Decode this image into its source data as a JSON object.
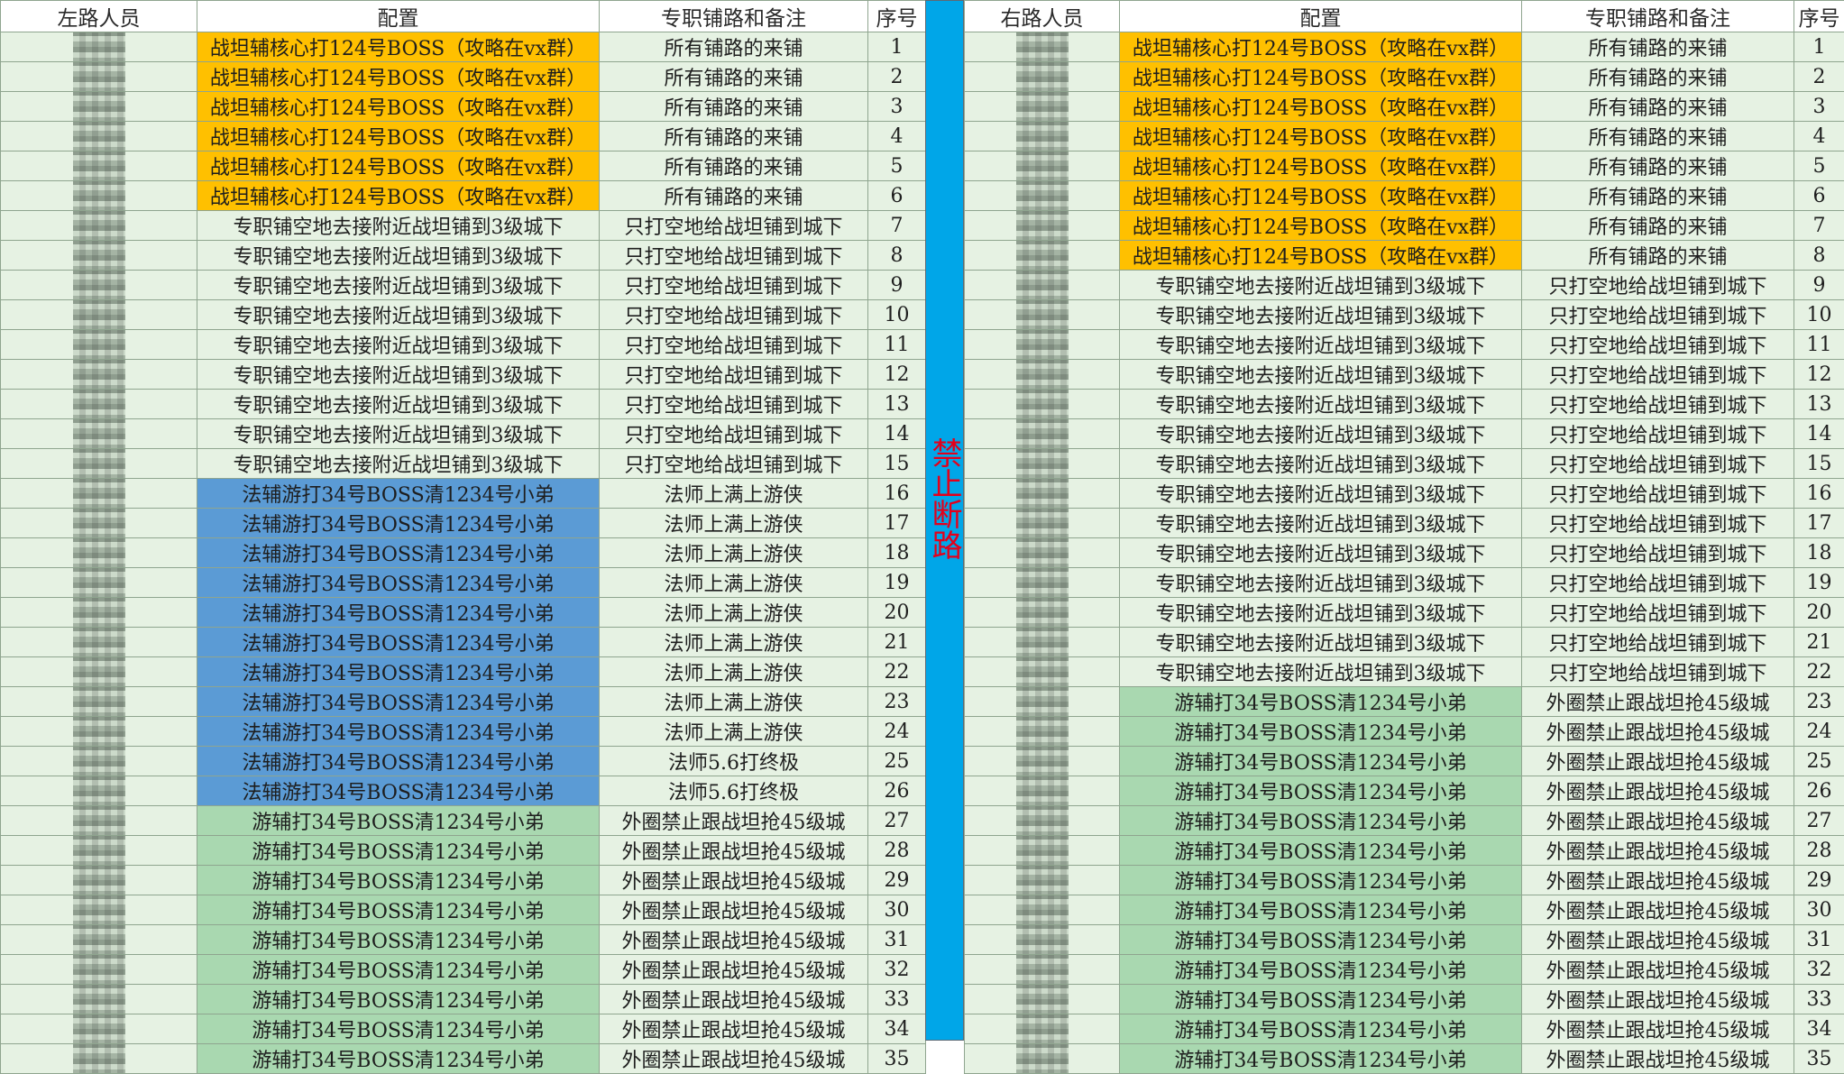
{
  "left": {
    "headers": [
      "左路人员",
      "配置",
      "专职铺路和备注",
      "序号"
    ],
    "rows": [
      {
        "name": "",
        "config": "战坦辅核心打124号BOSS（攻略在vx群）",
        "note": "所有铺路的来铺",
        "num": "1",
        "style": "org",
        "red": true
      },
      {
        "name": "",
        "config": "战坦辅核心打124号BOSS（攻略在vx群）",
        "note": "所有铺路的来铺",
        "num": "2",
        "style": "org",
        "red": true
      },
      {
        "name": "",
        "config": "战坦辅核心打124号BOSS（攻略在vx群）",
        "note": "所有铺路的来铺",
        "num": "3",
        "style": "org",
        "red": true
      },
      {
        "name": "",
        "config": "战坦辅核心打124号BOSS（攻略在vx群）",
        "note": "所有铺路的来铺",
        "num": "4",
        "style": "org",
        "red": true
      },
      {
        "name": "",
        "config": "战坦辅核心打124号BOSS（攻略在vx群）",
        "note": "所有铺路的来铺",
        "num": "5",
        "style": "org",
        "red": true
      },
      {
        "name": "",
        "config": "战坦辅核心打124号BOSS（攻略在vx群）",
        "note": "所有铺路的来铺",
        "num": "6",
        "style": "org",
        "red": true
      },
      {
        "name": "",
        "config": "专职铺空地去接附近战坦铺到3级城下",
        "note": "只打空地给战坦铺到城下",
        "num": "7",
        "style": "mid",
        "red": false
      },
      {
        "name": "",
        "config": "专职铺空地去接附近战坦铺到3级城下",
        "note": "只打空地给战坦铺到城下",
        "num": "8",
        "style": "mid",
        "red": false
      },
      {
        "name": "",
        "config": "专职铺空地去接附近战坦铺到3级城下",
        "note": "只打空地给战坦铺到城下",
        "num": "9",
        "style": "mid",
        "red": false
      },
      {
        "name": "",
        "config": "专职铺空地去接附近战坦铺到3级城下",
        "note": "只打空地给战坦铺到城下",
        "num": "10",
        "style": "mid",
        "red": false
      },
      {
        "name": "",
        "config": "专职铺空地去接附近战坦铺到3级城下",
        "note": "只打空地给战坦铺到城下",
        "num": "11",
        "style": "mid",
        "red": false
      },
      {
        "name": "",
        "config": "专职铺空地去接附近战坦铺到3级城下",
        "note": "只打空地给战坦铺到城下",
        "num": "12",
        "style": "mid",
        "red": false
      },
      {
        "name": "",
        "config": "专职铺空地去接附近战坦铺到3级城下",
        "note": "只打空地给战坦铺到城下",
        "num": "13",
        "style": "mid",
        "red": false
      },
      {
        "name": "",
        "config": "专职铺空地去接附近战坦铺到3级城下",
        "note": "只打空地给战坦铺到城下",
        "num": "14",
        "style": "mid",
        "red": false
      },
      {
        "name": "",
        "config": "专职铺空地去接附近战坦铺到3级城下",
        "note": "只打空地给战坦铺到城下",
        "num": "15",
        "style": "mid",
        "red": false
      },
      {
        "name": "",
        "config": "法辅游打34号BOSS清1234号小弟",
        "note": "法师上满上游侠",
        "num": "16",
        "style": "blu",
        "red": false
      },
      {
        "name": "",
        "config": "法辅游打34号BOSS清1234号小弟",
        "note": "法师上满上游侠",
        "num": "17",
        "style": "blu",
        "red": false
      },
      {
        "name": "",
        "config": "法辅游打34号BOSS清1234号小弟",
        "note": "法师上满上游侠",
        "num": "18",
        "style": "blu",
        "red": false
      },
      {
        "name": "",
        "config": "法辅游打34号BOSS清1234号小弟",
        "note": "法师上满上游侠",
        "num": "19",
        "style": "blu",
        "red": false
      },
      {
        "name": "",
        "config": "法辅游打34号BOSS清1234号小弟",
        "note": "法师上满上游侠",
        "num": "20",
        "style": "blu",
        "red": false
      },
      {
        "name": "",
        "config": "法辅游打34号BOSS清1234号小弟",
        "note": "法师上满上游侠",
        "num": "21",
        "style": "blu",
        "red": false
      },
      {
        "name": "",
        "config": "法辅游打34号BOSS清1234号小弟",
        "note": "法师上满上游侠",
        "num": "22",
        "style": "blu",
        "red": false
      },
      {
        "name": "",
        "config": "法辅游打34号BOSS清1234号小弟",
        "note": "法师上满上游侠",
        "num": "23",
        "style": "blu",
        "red": false
      },
      {
        "name": "",
        "config": "法辅游打34号BOSS清1234号小弟",
        "note": "法师上满上游侠",
        "num": "24",
        "style": "blu",
        "red": false
      },
      {
        "name": "",
        "config": "法辅游打34号BOSS清1234号小弟",
        "note": "法师5.6打终极",
        "num": "25",
        "style": "blu",
        "red": false
      },
      {
        "name": "",
        "config": "法辅游打34号BOSS清1234号小弟",
        "note": "法师5.6打终极",
        "num": "26",
        "style": "blu",
        "red": false
      },
      {
        "name": "",
        "config": "游辅打34号BOSS清1234号小弟",
        "note": "外圈禁止跟战坦抢45级城",
        "num": "27",
        "style": "grn",
        "red": false
      },
      {
        "name": "",
        "config": "游辅打34号BOSS清1234号小弟",
        "note": "外圈禁止跟战坦抢45级城",
        "num": "28",
        "style": "grn",
        "red": false
      },
      {
        "name": "",
        "config": "游辅打34号BOSS清1234号小弟",
        "note": "外圈禁止跟战坦抢45级城",
        "num": "29",
        "style": "grn",
        "red": false
      },
      {
        "name": "",
        "config": "游辅打34号BOSS清1234号小弟",
        "note": "外圈禁止跟战坦抢45级城",
        "num": "30",
        "style": "grn",
        "red": false
      },
      {
        "name": "",
        "config": "游辅打34号BOSS清1234号小弟",
        "note": "外圈禁止跟战坦抢45级城",
        "num": "31",
        "style": "grn",
        "red": false
      },
      {
        "name": "",
        "config": "游辅打34号BOSS清1234号小弟",
        "note": "外圈禁止跟战坦抢45级城",
        "num": "32",
        "style": "grn",
        "red": false
      },
      {
        "name": "",
        "config": "游辅打34号BOSS清1234号小弟",
        "note": "外圈禁止跟战坦抢45级城",
        "num": "33",
        "style": "grn",
        "red": false
      },
      {
        "name": "",
        "config": "游辅打34号BOSS清1234号小弟",
        "note": "外圈禁止跟战坦抢45级城",
        "num": "34",
        "style": "grn",
        "red": false
      },
      {
        "name": "",
        "config": "游辅打34号BOSS清1234号小弟",
        "note": "外圈禁止跟战坦抢45级城",
        "num": "35",
        "style": "grn",
        "red": false
      }
    ]
  },
  "divider_text": "禁止断路",
  "right": {
    "headers": [
      "右路人员",
      "配置",
      "专职铺路和备注",
      "序号"
    ],
    "rows": [
      {
        "name": "",
        "config": "战坦辅核心打124号BOSS（攻略在vx群）",
        "note": "所有铺路的来铺",
        "num": "1",
        "style": "org",
        "red": true
      },
      {
        "name": "",
        "config": "战坦辅核心打124号BOSS（攻略在vx群）",
        "note": "所有铺路的来铺",
        "num": "2",
        "style": "org",
        "red": true
      },
      {
        "name": "",
        "config": "战坦辅核心打124号BOSS（攻略在vx群）",
        "note": "所有铺路的来铺",
        "num": "3",
        "style": "org",
        "red": true
      },
      {
        "name": "",
        "config": "战坦辅核心打124号BOSS（攻略在vx群）",
        "note": "所有铺路的来铺",
        "num": "4",
        "style": "org",
        "red": true
      },
      {
        "name": "",
        "config": "战坦辅核心打124号BOSS（攻略在vx群）",
        "note": "所有铺路的来铺",
        "num": "5",
        "style": "org",
        "red": true
      },
      {
        "name": "",
        "config": "战坦辅核心打124号BOSS（攻略在vx群）",
        "note": "所有铺路的来铺",
        "num": "6",
        "style": "org",
        "red": true
      },
      {
        "name": "",
        "config": "战坦辅核心打124号BOSS（攻略在vx群）",
        "note": "所有铺路的来铺",
        "num": "7",
        "style": "org",
        "red": true
      },
      {
        "name": "",
        "config": "战坦辅核心打124号BOSS（攻略在vx群）",
        "note": "所有铺路的来铺",
        "num": "8",
        "style": "org",
        "red": true
      },
      {
        "name": "",
        "config": "专职铺空地去接附近战坦铺到3级城下",
        "note": "只打空地给战坦铺到城下",
        "num": "9",
        "style": "mid",
        "red": false
      },
      {
        "name": "",
        "config": "专职铺空地去接附近战坦铺到3级城下",
        "note": "只打空地给战坦铺到城下",
        "num": "10",
        "style": "mid",
        "red": false
      },
      {
        "name": "",
        "config": "专职铺空地去接附近战坦铺到3级城下",
        "note": "只打空地给战坦铺到城下",
        "num": "11",
        "style": "mid",
        "red": false
      },
      {
        "name": "",
        "config": "专职铺空地去接附近战坦铺到3级城下",
        "note": "只打空地给战坦铺到城下",
        "num": "12",
        "style": "mid",
        "red": false
      },
      {
        "name": "",
        "config": "专职铺空地去接附近战坦铺到3级城下",
        "note": "只打空地给战坦铺到城下",
        "num": "13",
        "style": "mid",
        "red": false
      },
      {
        "name": "",
        "config": "专职铺空地去接附近战坦铺到3级城下",
        "note": "只打空地给战坦铺到城下",
        "num": "14",
        "style": "mid",
        "red": false
      },
      {
        "name": "",
        "config": "专职铺空地去接附近战坦铺到3级城下",
        "note": "只打空地给战坦铺到城下",
        "num": "15",
        "style": "mid",
        "red": false
      },
      {
        "name": "",
        "config": "专职铺空地去接附近战坦铺到3级城下",
        "note": "只打空地给战坦铺到城下",
        "num": "16",
        "style": "mid",
        "red": false
      },
      {
        "name": "",
        "config": "专职铺空地去接附近战坦铺到3级城下",
        "note": "只打空地给战坦铺到城下",
        "num": "17",
        "style": "mid",
        "red": false
      },
      {
        "name": "",
        "config": "专职铺空地去接附近战坦铺到3级城下",
        "note": "只打空地给战坦铺到城下",
        "num": "18",
        "style": "mid",
        "red": false
      },
      {
        "name": "",
        "config": "专职铺空地去接附近战坦铺到3级城下",
        "note": "只打空地给战坦铺到城下",
        "num": "19",
        "style": "mid",
        "red": false
      },
      {
        "name": "",
        "config": "专职铺空地去接附近战坦铺到3级城下",
        "note": "只打空地给战坦铺到城下",
        "num": "20",
        "style": "mid",
        "red": false
      },
      {
        "name": "",
        "config": "专职铺空地去接附近战坦铺到3级城下",
        "note": "只打空地给战坦铺到城下",
        "num": "21",
        "style": "mid",
        "red": false
      },
      {
        "name": "",
        "config": "专职铺空地去接附近战坦铺到3级城下",
        "note": "只打空地给战坦铺到城下",
        "num": "22",
        "style": "mid",
        "red": false
      },
      {
        "name": "",
        "config": "游辅打34号BOSS清1234号小弟",
        "note": "外圈禁止跟战坦抢45级城",
        "num": "23",
        "style": "grn",
        "red": false
      },
      {
        "name": "",
        "config": "游辅打34号BOSS清1234号小弟",
        "note": "外圈禁止跟战坦抢45级城",
        "num": "24",
        "style": "grn",
        "red": false
      },
      {
        "name": "",
        "config": "游辅打34号BOSS清1234号小弟",
        "note": "外圈禁止跟战坦抢45级城",
        "num": "25",
        "style": "grn",
        "red": false
      },
      {
        "name": "",
        "config": "游辅打34号BOSS清1234号小弟",
        "note": "外圈禁止跟战坦抢45级城",
        "num": "26",
        "style": "grn",
        "red": false
      },
      {
        "name": "",
        "config": "游辅打34号BOSS清1234号小弟",
        "note": "外圈禁止跟战坦抢45级城",
        "num": "27",
        "style": "grn",
        "red": false
      },
      {
        "name": "",
        "config": "游辅打34号BOSS清1234号小弟",
        "note": "外圈禁止跟战坦抢45级城",
        "num": "28",
        "style": "grn",
        "red": false
      },
      {
        "name": "",
        "config": "游辅打34号BOSS清1234号小弟",
        "note": "外圈禁止跟战坦抢45级城",
        "num": "29",
        "style": "grn",
        "red": false
      },
      {
        "name": "",
        "config": "游辅打34号BOSS清1234号小弟",
        "note": "外圈禁止跟战坦抢45级城",
        "num": "30",
        "style": "grn",
        "red": false
      },
      {
        "name": "",
        "config": "游辅打34号BOSS清1234号小弟",
        "note": "外圈禁止跟战坦抢45级城",
        "num": "31",
        "style": "grn",
        "red": false
      },
      {
        "name": "",
        "config": "游辅打34号BOSS清1234号小弟",
        "note": "外圈禁止跟战坦抢45级城",
        "num": "32",
        "style": "grn",
        "red": false
      },
      {
        "name": "",
        "config": "游辅打34号BOSS清1234号小弟",
        "note": "外圈禁止跟战坦抢45级城",
        "num": "33",
        "style": "grn",
        "red": false
      },
      {
        "name": "",
        "config": "游辅打34号BOSS清1234号小弟",
        "note": "外圈禁止跟战坦抢45级城",
        "num": "34",
        "style": "grn",
        "red": false
      },
      {
        "name": "",
        "config": "游辅打34号BOSS清1234号小弟",
        "note": "外圈禁止跟战坦抢45级城",
        "num": "35",
        "style": "grn",
        "red": false
      }
    ]
  },
  "colors": {
    "orange": "#ffc000",
    "blue": "#5b9bd5",
    "green": "#a9d8b0",
    "light_green": "#e6f2e3",
    "divider": "#00a6e8",
    "red_text": "#e00000"
  }
}
